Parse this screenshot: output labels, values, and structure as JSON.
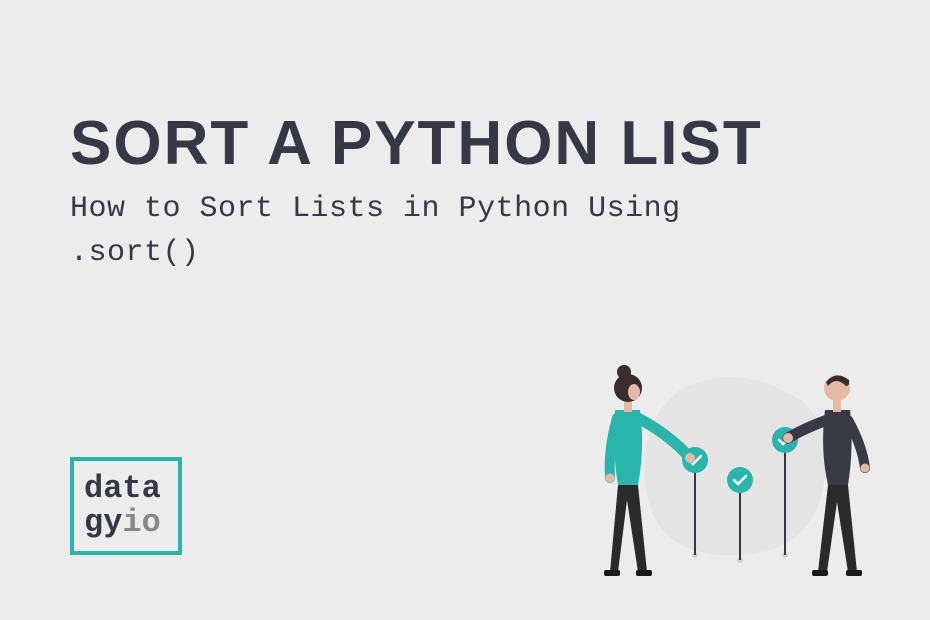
{
  "title": "Sort a Python List",
  "subtitle": "How to Sort Lists in Python Using .sort()",
  "logo": {
    "line1": "data",
    "line2_prefix": "gy",
    "line2_suffix": "io"
  },
  "colors": {
    "bg": "#ececec",
    "text": "#373846",
    "accent": "#29b5ac",
    "muted": "#888888"
  },
  "illustration": {
    "description": "two-people-checklist-illustration",
    "person_left": {
      "shirt": "#29b5ac",
      "pants": "#2a2a2a",
      "head": "#3a2d2d"
    },
    "person_right": {
      "shirt": "#3a3a46",
      "pants": "#2a2a2a",
      "head": "#e6b9a5"
    },
    "markers": {
      "circle_fill": "#29b5ac",
      "check": "white",
      "stem": "#373846"
    },
    "marker_count": 3
  }
}
